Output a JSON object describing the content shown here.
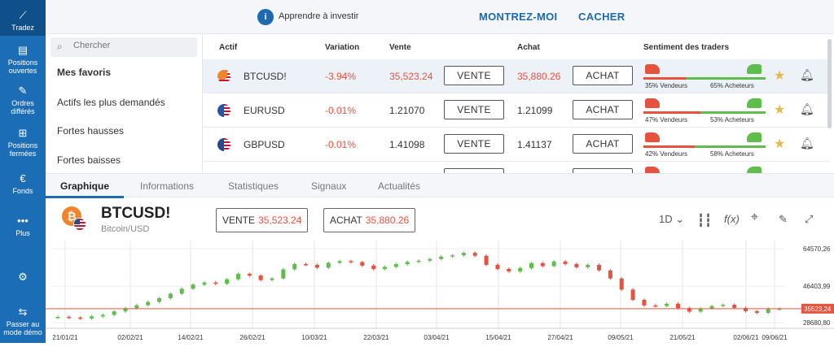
{
  "sidebar": {
    "items": [
      {
        "label": "Tradez",
        "icon": "trend-icon",
        "glyph": "⟋"
      },
      {
        "label": "Positions ouvertes",
        "icon": "document-icon",
        "glyph": "▤"
      },
      {
        "label": "Ordres différés",
        "icon": "edit-icon",
        "glyph": "✎"
      },
      {
        "label": "Positions fermées",
        "icon": "briefcase-icon",
        "glyph": "⊞"
      },
      {
        "label": "Fonds",
        "icon": "euro-icon",
        "glyph": "€"
      },
      {
        "label": "Plus",
        "icon": "more-icon",
        "glyph": "•••"
      },
      {
        "label": "",
        "icon": "settings-icon",
        "glyph": "⚙"
      },
      {
        "label": "Passer au mode démo",
        "icon": "switch-icon",
        "glyph": "⇆"
      }
    ]
  },
  "topbar": {
    "info_text": "Apprendre à investir",
    "show_label": "MONTREZ-MOI",
    "hide_label": "CACHER"
  },
  "filters": {
    "search_placeholder": "Chercher",
    "items": [
      "Mes favoris",
      "Actifs les plus demandés",
      "Fortes hausses",
      "Fortes baisses"
    ]
  },
  "table": {
    "headers": {
      "asset": "Actif",
      "change": "Variation",
      "sell": "Vente",
      "buy": "Achat",
      "sentiment": "Sentiment des traders"
    },
    "sell_label": "VENTE",
    "buy_label": "ACHAT",
    "rows": [
      {
        "symbol": "BTCUSD!",
        "change": "-3.94%",
        "sell": "35,523.24",
        "buy": "35,880.26",
        "sellers": "35% Vendeurs",
        "buyers": "65% Acheteurs",
        "sellers_pct": 35,
        "red_prices": true
      },
      {
        "symbol": "EURUSD",
        "change": "-0.01%",
        "sell": "1.21070",
        "buy": "1.21099",
        "sellers": "47% Vendeurs",
        "buyers": "53% Acheteurs",
        "sellers_pct": 47,
        "red_prices": false
      },
      {
        "symbol": "GBPUSD",
        "change": "-0.01%",
        "sell": "1.41098",
        "buy": "1.41137",
        "sellers": "42% Vendeurs",
        "buyers": "58% Acheteurs",
        "sellers_pct": 42,
        "red_prices": false
      }
    ]
  },
  "tabs": [
    "Graphique",
    "Informations",
    "Statistiques",
    "Signaux",
    "Actualités"
  ],
  "instrument": {
    "symbol": "BTCUSD!",
    "name": "Bitcoin/USD",
    "sell_label": "VENTE",
    "sell_price": "35,523.24",
    "buy_label": "ACHAT",
    "buy_price": "35,880.26",
    "timeframe": "1D"
  },
  "colors": {
    "accent": "#1d6ab1",
    "sidebar": "#1b6db5",
    "down": "#e5533f",
    "up": "#5fbd4c",
    "star": "#e8b84a"
  },
  "chart_data": {
    "type": "candlestick",
    "x_ticks": [
      "21/01/21",
      "02/02/21",
      "14/02/21",
      "26/02/21",
      "10/03/21",
      "22/03/21",
      "03/04/21",
      "15/04/21",
      "27/04/21",
      "09/05/21",
      "21/05/21",
      "02/06/21",
      "09/06/21"
    ],
    "y_ticks": [
      "64570,26",
      "46403,99",
      "28680,80"
    ],
    "current_price_label": "35523,24",
    "ylim": [
      26000,
      67000
    ],
    "closes": [
      31500,
      31200,
      30800,
      31800,
      32500,
      34200,
      35800,
      37200,
      38800,
      40600,
      42800,
      45200,
      47200,
      48200,
      47600,
      49800,
      52400,
      51600,
      49400,
      50200,
      54600,
      57200,
      56800,
      55400,
      57800,
      58600,
      58100,
      56400,
      54800,
      55800,
      57100,
      58200,
      58800,
      59600,
      60800,
      61400,
      62600,
      61200,
      56800,
      54800,
      53600,
      55200,
      57600,
      56200,
      58400,
      57200,
      55600,
      56800,
      54100,
      50200,
      44800,
      39800,
      37100,
      36800,
      37900,
      35800,
      34100,
      35600,
      36800,
      37400,
      35900,
      34300,
      33500,
      35500,
      35523
    ]
  }
}
